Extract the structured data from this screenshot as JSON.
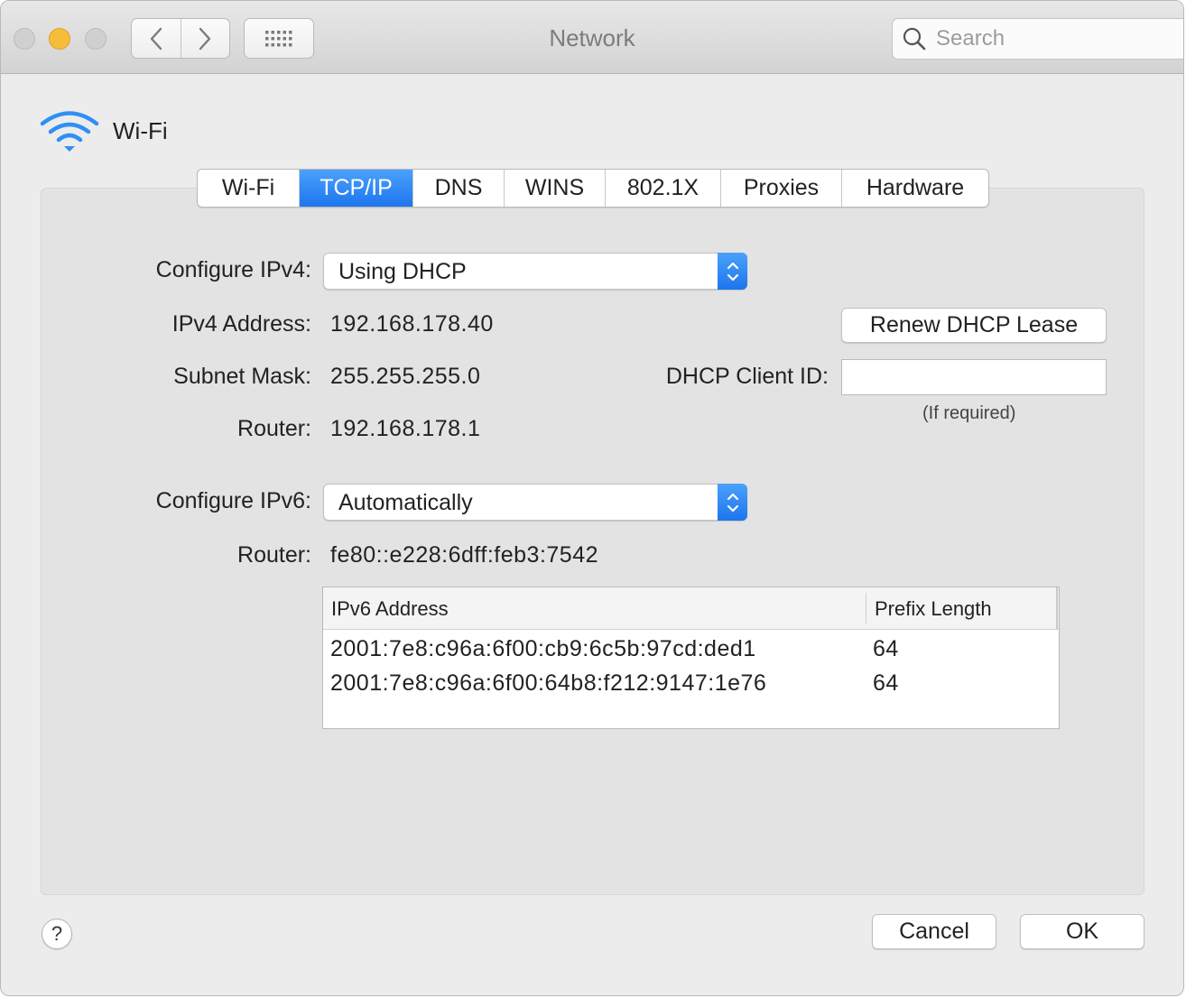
{
  "window": {
    "title": "Network",
    "search": {
      "placeholder": "Search",
      "value": ""
    }
  },
  "toolbar": {
    "back_icon": "chevron-left-icon",
    "forward_icon": "chevron-right-icon",
    "show_all_icon": "grid-icon"
  },
  "header": {
    "label": "Wi-Fi",
    "icon": "wifi-icon"
  },
  "tabs": [
    {
      "label": "Wi-Fi",
      "active": false
    },
    {
      "label": "TCP/IP",
      "active": true
    },
    {
      "label": "DNS",
      "active": false
    },
    {
      "label": "WINS",
      "active": false
    },
    {
      "label": "802.1X",
      "active": false
    },
    {
      "label": "Proxies",
      "active": false
    },
    {
      "label": "Hardware",
      "active": false
    }
  ],
  "ipv4": {
    "configure_label": "Configure IPv4:",
    "configure_value": "Using DHCP",
    "address_label": "IPv4 Address:",
    "address_value": "192.168.178.40",
    "subnet_label": "Subnet Mask:",
    "subnet_value": "255.255.255.0",
    "router_label": "Router:",
    "router_value": "192.168.178.1",
    "renew_button": "Renew DHCP Lease",
    "client_id_label": "DHCP Client ID:",
    "client_id_value": "",
    "client_id_note": "(If required)"
  },
  "ipv6": {
    "configure_label": "Configure IPv6:",
    "configure_value": "Automatically",
    "router_label": "Router:",
    "router_value": "fe80::e228:6dff:feb3:7542",
    "table": {
      "columns": [
        "IPv6 Address",
        "Prefix Length"
      ],
      "rows": [
        [
          "2001:7e8:c96a:6f00:cb9:6c5b:97cd:ded1",
          "64"
        ],
        [
          "2001:7e8:c96a:6f00:64b8:f212:9147:1e76",
          "64"
        ]
      ]
    }
  },
  "footer": {
    "help": "?",
    "cancel": "Cancel",
    "ok": "OK"
  },
  "colors": {
    "accent": "#1d75ee",
    "minimize": "#f6bd3b",
    "wifi_icon": "#2f8ff4"
  }
}
